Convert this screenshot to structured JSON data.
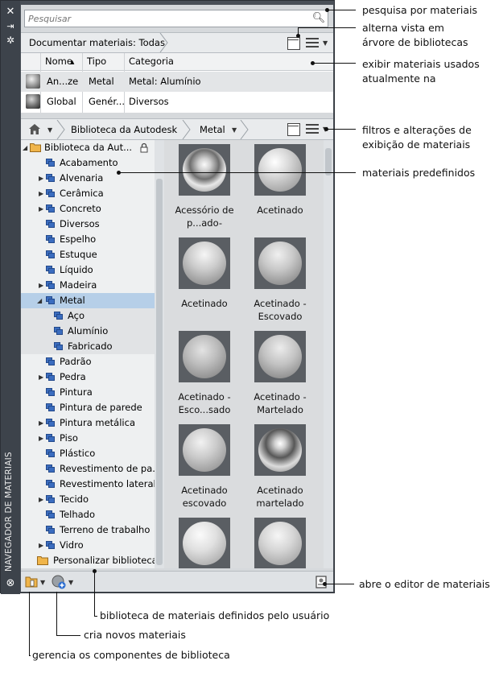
{
  "palette": {
    "primary": "Metal",
    "frame": "#4a5058",
    "selection": "#b6cfe8",
    "icon_blue": "#3b6dbf"
  },
  "window": {
    "title": "NAVEGADOR DE MATERIAIS",
    "close_icon": "close-icon",
    "autohide_icon": "autohide-icon",
    "properties_icon": "properties-icon",
    "settings_icon": "settings-icon"
  },
  "search": {
    "placeholder": "Pesquisar",
    "value": ""
  },
  "document_bar": {
    "label": "Documentar materiais: Todas"
  },
  "doc_table": {
    "columns": [
      "Nome",
      "Tipo",
      "Categoria"
    ],
    "rows": [
      {
        "name": "An...ze",
        "type": "Metal",
        "category": "Metal: Alumínio"
      },
      {
        "name": "Global",
        "type": "Genér...",
        "category": "Diversos"
      }
    ]
  },
  "library_bar": {
    "crumbs": [
      "Biblioteca da Autodesk",
      "Metal"
    ]
  },
  "tree": {
    "root": "Biblioteca da Aut...",
    "items": [
      "Acabamento",
      "Alvenaria",
      "Cerâmica",
      "Concreto",
      "Diversos",
      "Espelho",
      "Estuque",
      "Líquido",
      "Madeira",
      "Metal",
      "Aço",
      "Alumínio",
      "Fabricado",
      "Padrão",
      "Pedra",
      "Pintura",
      "Pintura de parede",
      "Pintura metálica",
      "Piso",
      "Plástico",
      "Revestimento de pa...",
      "Revestimento lateral",
      "Tecido",
      "Telhado",
      "Terreno de trabalho",
      "Vidro"
    ],
    "custom": "Personalizar biblioteca"
  },
  "materials": [
    "Acessório de p...ado-",
    "Acetinado",
    "Acetinado",
    "Acetinado - Escovado",
    "Acetinado - Esco...sado",
    "Acetinado - Martelado",
    "Acetinado escovado",
    "Acetinado martelado",
    "",
    ""
  ],
  "callouts": {
    "search": "pesquisa por materiais",
    "toggle1": "alterna vista em",
    "toggle2": "árvore de bibliotecas",
    "doc1": "exibir materiais usados",
    "doc2": "atualmente na",
    "filter1": "filtros e alterações de",
    "filter2": "exibição de materiais",
    "predefined": "materiais predefinidos",
    "editor": "abre o editor de materiais",
    "userlib": "biblioteca de materiais definidos pelo usuário",
    "create": "cria novos materiais",
    "manage": "gerencia os componentes de biblioteca"
  }
}
